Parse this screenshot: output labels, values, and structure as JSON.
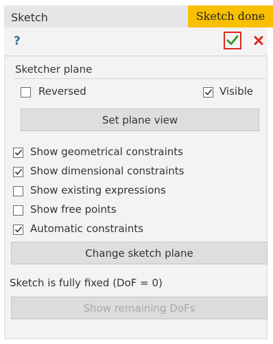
{
  "window": {
    "title": "Sketch",
    "callout": "Sketch done"
  },
  "toolbar": {
    "help_glyph": "?",
    "icons": [
      "help-icon",
      "checkmark-icon",
      "close-icon"
    ],
    "ok_color": "#3a9a2a",
    "close_color": "#d8281d"
  },
  "sketcher_plane": {
    "title": "Sketcher plane",
    "reversed": {
      "label": "Reversed",
      "checked": false
    },
    "visible": {
      "label": "Visible",
      "checked": true
    },
    "set_plane_view_label": "Set plane view"
  },
  "options": [
    {
      "label": "Show geometrical constraints",
      "checked": true
    },
    {
      "label": "Show dimensional constraints",
      "checked": true
    },
    {
      "label": "Show existing expressions",
      "checked": false
    },
    {
      "label": "Show free points",
      "checked": false
    },
    {
      "label": "Automatic constraints",
      "checked": true
    }
  ],
  "change_sketch_plane_label": "Change sketch plane",
  "status": "Sketch is fully fixed (DoF = 0)",
  "show_remaining_dofs_label": "Show remaining DoFs"
}
